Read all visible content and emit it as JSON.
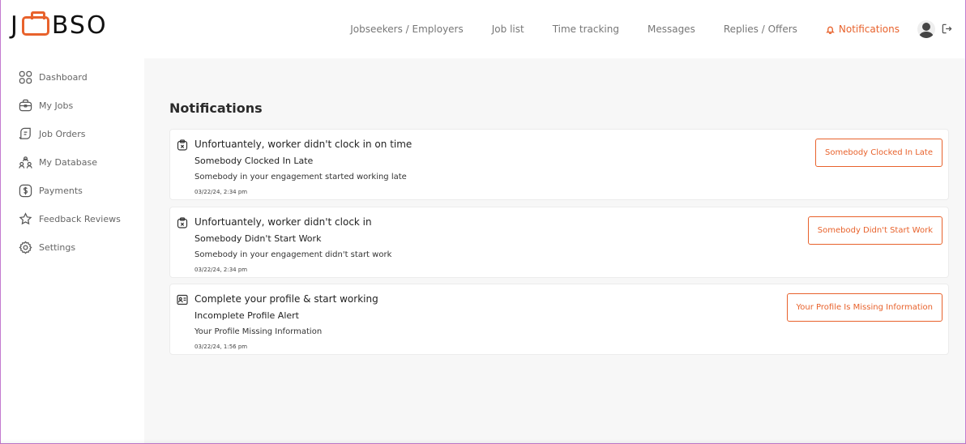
{
  "brand": {
    "letters": [
      "J",
      "BSO"
    ],
    "accent": "#e8622c"
  },
  "sidebar": {
    "items": [
      {
        "label": "Dashboard",
        "icon": "grid-icon"
      },
      {
        "label": "My Jobs",
        "icon": "briefcase-icon"
      },
      {
        "label": "Job Orders",
        "icon": "order-icon"
      },
      {
        "label": "My Database",
        "icon": "people-icon"
      },
      {
        "label": "Payments",
        "icon": "dollar-icon"
      },
      {
        "label": "Feedback Reviews",
        "icon": "star-icon"
      },
      {
        "label": "Settings",
        "icon": "gear-icon"
      }
    ]
  },
  "topnav": {
    "links": [
      "Jobseekers / Employers",
      "Job list",
      "Time tracking",
      "Messages",
      "Replies / Offers"
    ],
    "active": "Notifications"
  },
  "main": {
    "title": "Notifications",
    "notifications": [
      {
        "icon": "clipboard-x-icon",
        "title": "Unfortuantely, worker didn't clock in on time",
        "subtitle": "Somebody Clocked In Late",
        "description": "Somebody in your engagement started working late",
        "time": "03/22/24, 2:34 pm",
        "button": "Somebody Clocked In Late"
      },
      {
        "icon": "clipboard-x-icon",
        "title": "Unfortuantely, worker didn't clock in",
        "subtitle": "Somebody Didn't Start Work",
        "description": "Somebody in your engagement didn't start work",
        "time": "03/22/24, 2:34 pm",
        "button": "Somebody Didn't Start Work"
      },
      {
        "icon": "profile-card-icon",
        "title": "Complete your profile & start working",
        "subtitle": "Incomplete Profile Alert",
        "description": "Your Profile Missing Information",
        "time": "03/22/24, 1:56 pm",
        "button": "Your Profile Is Missing Information"
      }
    ]
  }
}
